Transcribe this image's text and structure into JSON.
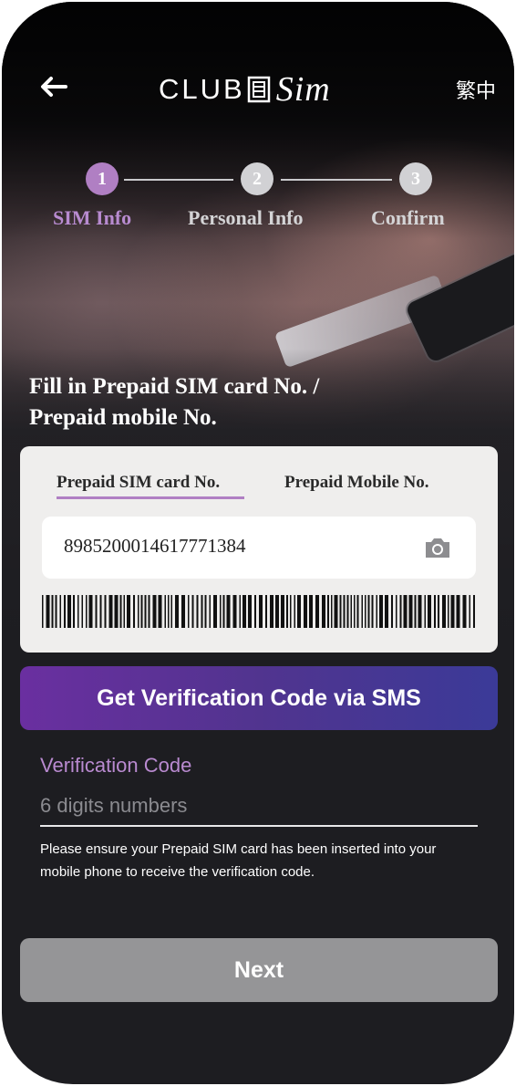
{
  "header": {
    "logo_club": "CLUB",
    "logo_sim": "Sim",
    "language_toggle": "繁中"
  },
  "stepper": {
    "steps": [
      {
        "number": "1",
        "label": "SIM Info",
        "active": true
      },
      {
        "number": "2",
        "label": "Personal Info",
        "active": false
      },
      {
        "number": "3",
        "label": "Confirm",
        "active": false
      }
    ]
  },
  "form": {
    "title_line1": "Fill in Prepaid SIM card No. /",
    "title_line2": "Prepaid mobile No.",
    "tabs": {
      "sim_card": "Prepaid SIM card No.",
      "mobile": "Prepaid Mobile No.",
      "selected": "sim_card"
    },
    "sim_card_number": "8985200014617771384",
    "sms_button": "Get Verification Code via SMS",
    "verification": {
      "label": "Verification Code",
      "placeholder": "6 digits numbers",
      "value": ""
    },
    "note": "Please ensure your Prepaid SIM card has been inserted into your mobile phone to receive the verification code.",
    "next_button": "Next"
  },
  "colors": {
    "accent_purple": "#b07fc3",
    "sms_gradient_start": "#6a2fa0",
    "sms_gradient_end": "#3b3a98",
    "next_disabled": "#959597",
    "background": "#1d1d21"
  },
  "icons": {
    "back": "arrow-left-icon",
    "scan": "camera-icon"
  }
}
